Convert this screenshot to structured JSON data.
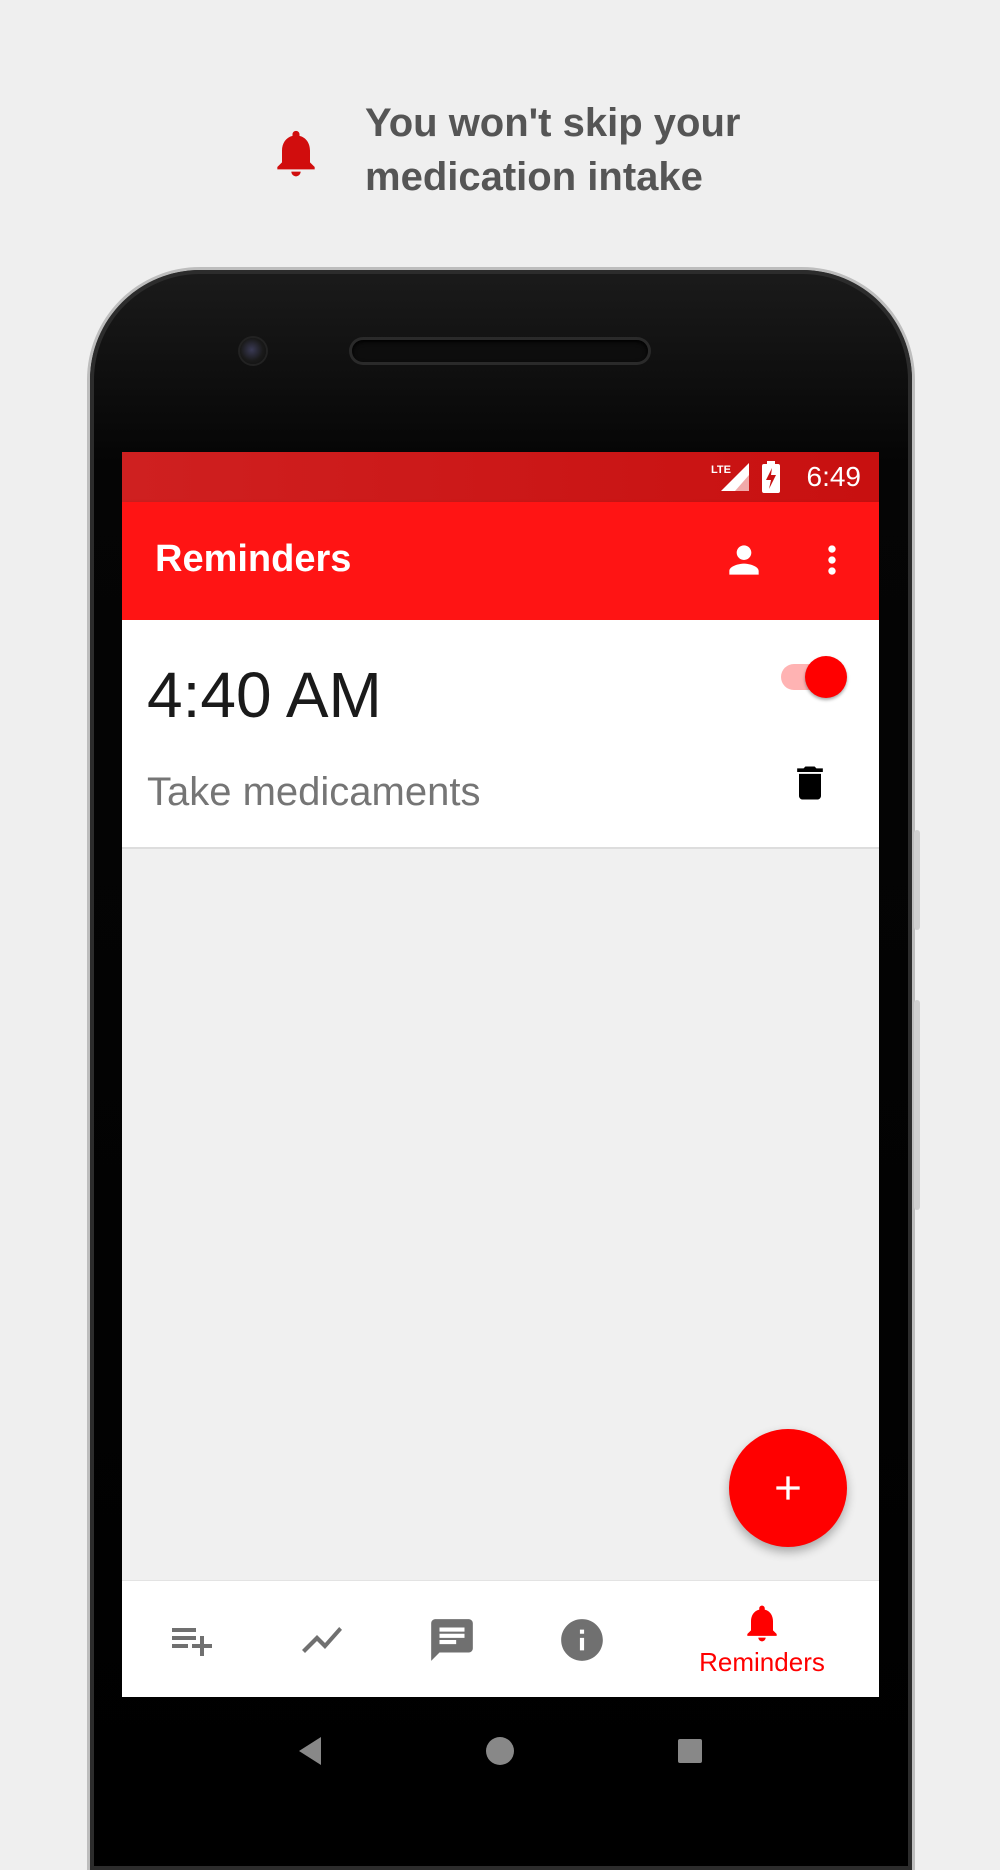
{
  "promo": {
    "line1": "You won't skip your",
    "line2": "medication intake",
    "icon": "bell-icon",
    "icon_color": "#d10d0d"
  },
  "status_bar": {
    "time": "6:49",
    "network": "LTE",
    "icons": [
      "lte-signal-icon",
      "battery-charging-icon"
    ]
  },
  "app_bar": {
    "title": "Reminders",
    "actions": [
      "account-icon",
      "more-vert-icon"
    ]
  },
  "reminders": [
    {
      "time": "4:40 AM",
      "label": "Take medicaments",
      "enabled": true
    }
  ],
  "fab": {
    "label": "+",
    "icon": "add-icon"
  },
  "bottom_nav": {
    "items": [
      {
        "icon": "playlist-add-icon",
        "label": ""
      },
      {
        "icon": "trending-icon",
        "label": ""
      },
      {
        "icon": "chat-icon",
        "label": ""
      },
      {
        "icon": "info-icon",
        "label": ""
      },
      {
        "icon": "bell-icon",
        "label": "Reminders",
        "active": true
      }
    ]
  },
  "colors": {
    "primary": "#ff1414",
    "status_bar": "#c81010",
    "accent": "#ff0000",
    "inactive_icon": "#707070"
  }
}
